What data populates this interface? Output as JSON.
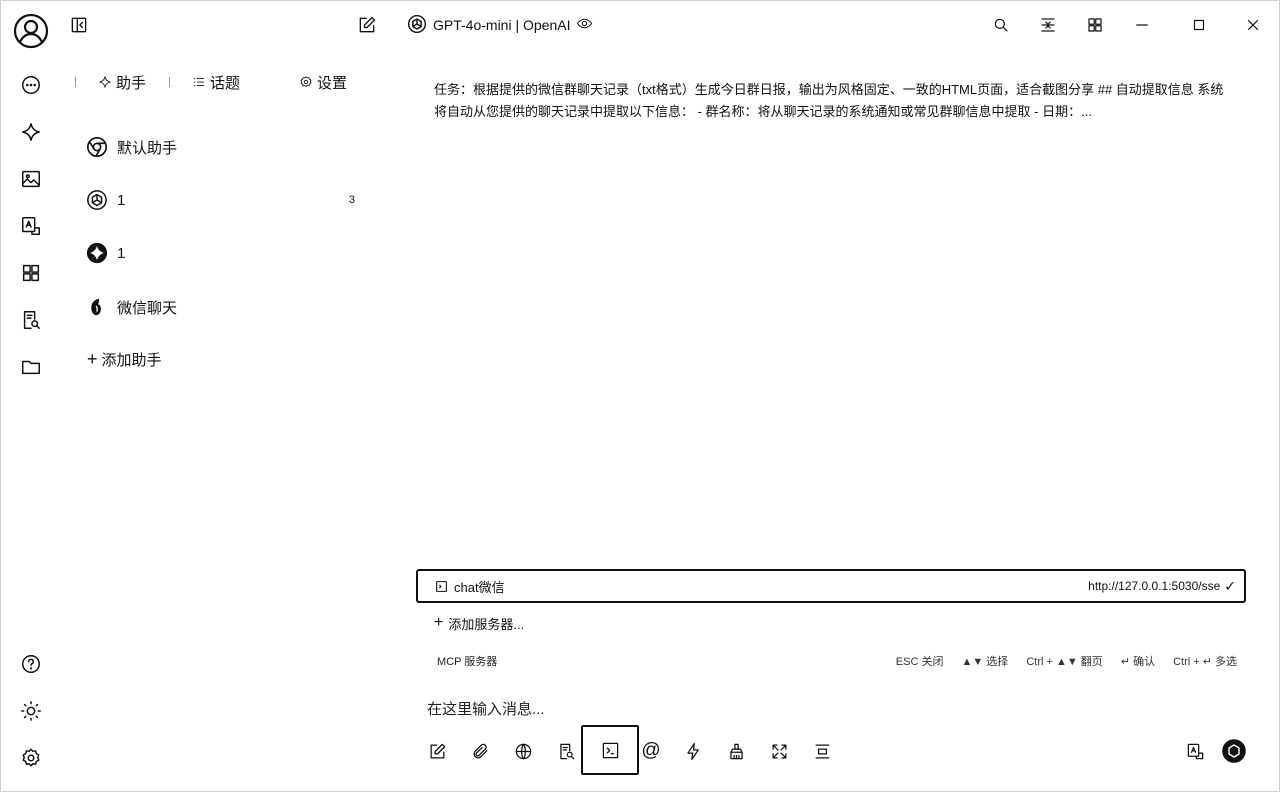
{
  "rail": {
    "items": [
      "chat-bubble-icon",
      "sparkle-icon",
      "image-icon",
      "translate-icon",
      "apps-grid-icon",
      "document-search-icon",
      "folder-icon"
    ],
    "bottom": [
      "help-icon",
      "sun-icon",
      "settings-icon"
    ]
  },
  "panel": {
    "tabs": [
      {
        "label": "助手",
        "icon": "sparkle-icon"
      },
      {
        "label": "话题",
        "icon": "list-icon"
      },
      {
        "label": "设置",
        "icon": "gear-icon"
      }
    ],
    "assistants": [
      {
        "name": "默认助手",
        "icon": "chrome-logo-icon",
        "count": ""
      },
      {
        "name": "1",
        "icon": "openai-logo-icon",
        "count": "3"
      },
      {
        "name": "1",
        "icon": "sparkle-logo-icon",
        "count": ""
      },
      {
        "name": "微信聊天",
        "icon": "leaf-logo-icon",
        "count": ""
      }
    ],
    "add_assistant_label": "添加助手"
  },
  "header": {
    "model_name": "GPT-4o-mini | OpenAI"
  },
  "conversation": {
    "prompt_preview": "任务：根据提供的微信群聊天记录（txt格式）生成今日群日报，输出为风格固定、一致的HTML页面，适合截图分享 ## 自动提取信息 系统将自动从您提供的聊天记录中提取以下信息： - 群名称：将从聊天记录的系统通知或常见群聊信息中提取 - 日期：..."
  },
  "mcp": {
    "server_name": "chat微信",
    "server_url": "http://127.0.0.1:5030/sse",
    "add_server_label": "添加服务器...",
    "section_label": "MCP 服务器",
    "hints": [
      "ESC 关闭",
      "▲▼ 选择",
      "Ctrl + ▲▼ 翻页",
      "↵ 确认",
      "Ctrl + ↵ 多选"
    ]
  },
  "input": {
    "placeholder": "在这里输入消息..."
  }
}
